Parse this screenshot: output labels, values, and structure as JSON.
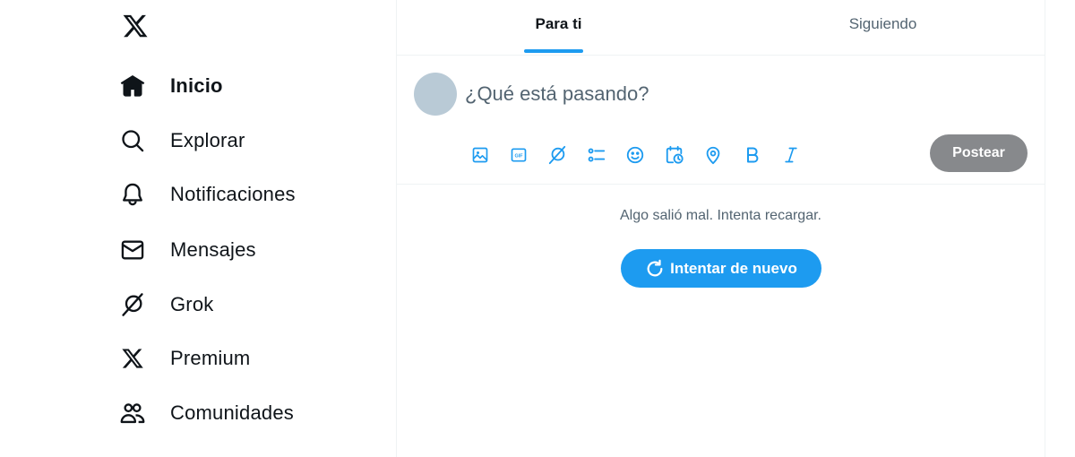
{
  "brand": {
    "logo": "x-logo-icon"
  },
  "sidebar": {
    "items": [
      {
        "label": "Inicio",
        "icon": "home-icon",
        "active": true
      },
      {
        "label": "Explorar",
        "icon": "search-icon"
      },
      {
        "label": "Notificaciones",
        "icon": "bell-icon"
      },
      {
        "label": "Mensajes",
        "icon": "envelope-icon"
      },
      {
        "label": "Grok",
        "icon": "grok-icon"
      },
      {
        "label": "Premium",
        "icon": "x-premium-icon"
      },
      {
        "label": "Comunidades",
        "icon": "communities-icon"
      }
    ]
  },
  "tabs": [
    {
      "label": "Para ti",
      "active": true
    },
    {
      "label": "Siguiendo",
      "active": false
    }
  ],
  "composer": {
    "placeholder": "¿Qué está pasando?",
    "tools": [
      "image-icon",
      "gif-icon",
      "grok-icon",
      "poll-icon",
      "emoji-icon",
      "schedule-icon",
      "location-icon",
      "bold-icon",
      "italic-icon"
    ],
    "post_label": "Postear"
  },
  "timeline": {
    "error_message": "Algo salió mal. Intenta recargar.",
    "retry_label": "Intentar de nuevo"
  },
  "colors": {
    "accent": "#1d9bf0",
    "post_disabled": "#87898c",
    "text": "#0f1419",
    "muted": "#536471"
  }
}
